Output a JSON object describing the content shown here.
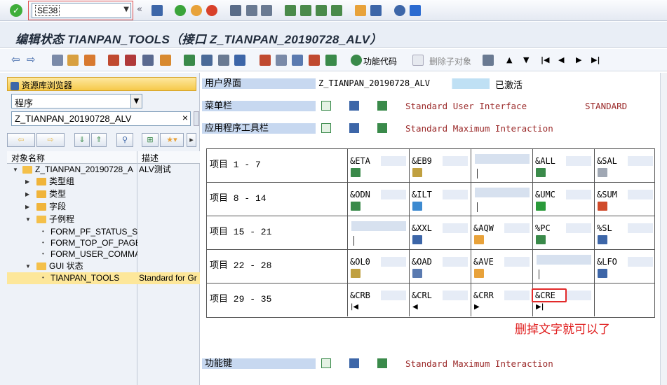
{
  "toolbar": {
    "command_value": "SE38"
  },
  "title": "编辑状态 TIANPAN_TOOLS（接口 Z_TIANPAN_20190728_ALV）",
  "appbar": {
    "function_code_label": "功能代码",
    "delete_child_label": "删除子对象"
  },
  "left": {
    "browser_title": "资源库浏览器",
    "select_value": "程序",
    "object_value": "Z_TIANPAN_20190728_ALV",
    "col_name": "对象名称",
    "col_desc": "描述",
    "tree": [
      {
        "label": "Z_TIANPAN_20190728_A",
        "desc": "ALV测试"
      },
      {
        "label": "类型组",
        "desc": ""
      },
      {
        "label": "类型",
        "desc": ""
      },
      {
        "label": "字段",
        "desc": ""
      },
      {
        "label": "子例程",
        "desc": ""
      },
      {
        "label": "FORM_PF_STATUS_SE",
        "desc": ""
      },
      {
        "label": "FORM_TOP_OF_PAGE",
        "desc": ""
      },
      {
        "label": "FORM_USER_COMMAN",
        "desc": ""
      },
      {
        "label": "GUI 状态",
        "desc": ""
      },
      {
        "label": "TIANPAN_TOOLS",
        "desc": "Standard for Gr"
      }
    ]
  },
  "right": {
    "ui_label": "用户界面",
    "ui_value": "Z_TIANPAN_20190728_ALV",
    "ui_status": "已激活",
    "menubar_label": "菜单栏",
    "menubar_text": "Standard User Interface",
    "menubar_std": "STANDARD",
    "apptb_label": "应用程序工具栏",
    "apptb_text": "Standard Maximum Interaction",
    "fkey_label": "功能键",
    "fkey_text": "Standard Maximum Interaction",
    "rows": [
      {
        "label": "项目  1 -  7",
        "codes": [
          "&ETA",
          "&EB9",
          "",
          "&ALL",
          "&SAL"
        ]
      },
      {
        "label": "项目  8 - 14",
        "codes": [
          "&ODN",
          "&ILT",
          "",
          "&UMC",
          "&SUM"
        ]
      },
      {
        "label": "项目 15 - 21",
        "codes": [
          "",
          "&XXL",
          "&AQW",
          "%PC",
          "%SL"
        ]
      },
      {
        "label": "项目 22 - 28",
        "codes": [
          "&OL0",
          "&OAD",
          "&AVE",
          "",
          "&LFO"
        ]
      },
      {
        "label": "项目 29 - 35",
        "codes": [
          "&CRB",
          "&CRL",
          "&CRR",
          "&CRE",
          ""
        ]
      }
    ],
    "annotation": "删掉文字就可以了"
  },
  "colors": {
    "accent": "#f6c94a",
    "label_bg": "#c7d8f0",
    "code_red": "#9b2a2a",
    "highlight": "#e22a2a"
  }
}
